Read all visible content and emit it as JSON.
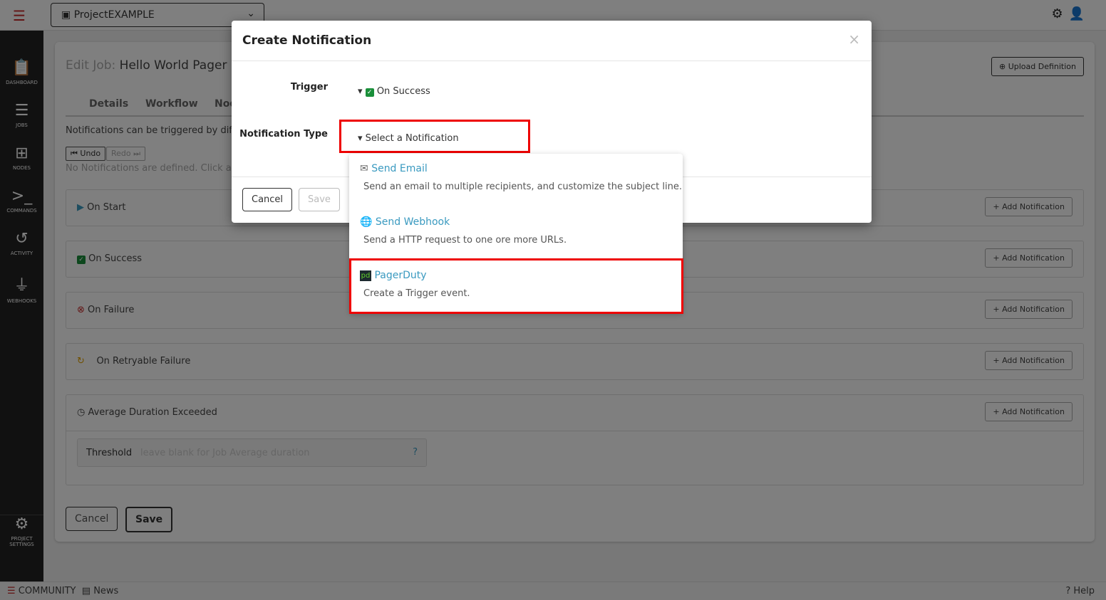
{
  "topbar": {
    "project": "ProjectEXAMPLE"
  },
  "sidebar": {
    "items": [
      {
        "label": "DASHBOARD",
        "icon": "clipboard-icon"
      },
      {
        "label": "JOBS",
        "icon": "list-check-icon"
      },
      {
        "label": "NODES",
        "icon": "sitemap-icon"
      },
      {
        "label": "COMMANDS",
        "icon": "terminal-icon"
      },
      {
        "label": "ACTIVITY",
        "icon": "history-icon"
      },
      {
        "label": "WEBHOOKS",
        "icon": "plug-icon"
      }
    ],
    "settings": "PROJECT SETTINGS"
  },
  "page": {
    "title_prefix": "Edit Job:",
    "title": "Hello World Pager D",
    "upload": "Upload Definition",
    "tabs": [
      "Details",
      "Workflow",
      "Nod"
    ],
    "desc": "Notifications can be triggered by diff",
    "undo": "Undo",
    "redo": "Redo",
    "empty": "No Notifications are defined. Click a",
    "rows": [
      {
        "label": "On Start",
        "add": "Add Notification"
      },
      {
        "label": "On Success",
        "add": "Add Notification"
      },
      {
        "label": "On Failure",
        "add": "Add Notification"
      },
      {
        "label": "On Retryable Failure",
        "add": "Add Notification"
      },
      {
        "label": "Average Duration Exceeded",
        "add": "Add Notification"
      }
    ],
    "threshold_label": "Threshold",
    "threshold_placeholder": "leave blank for Job Average duration",
    "cancel": "Cancel",
    "save": "Save"
  },
  "footer": {
    "community": "COMMUNITY",
    "news": "News",
    "help": "Help"
  },
  "modal": {
    "title": "Create Notification",
    "close": "×",
    "trigger_label": "Trigger",
    "trigger_value": "On Success",
    "type_label": "Notification Type",
    "type_value": "Select a Notification",
    "cancel": "Cancel",
    "save": "Save",
    "options": [
      {
        "title": "Send Email",
        "desc": "Send an email to multiple recipients, and customize the subject line.",
        "icon": "envelope-icon"
      },
      {
        "title": "Send Webhook",
        "desc": "Send a HTTP request to one ore more URLs.",
        "icon": "globe-icon"
      },
      {
        "title": "PagerDuty",
        "desc": "Create a Trigger event.",
        "icon": "pagerduty-icon"
      }
    ]
  },
  "colors": {
    "highlight": "#ee0000",
    "link": "#3a9ac0",
    "brand": "#c62828"
  }
}
